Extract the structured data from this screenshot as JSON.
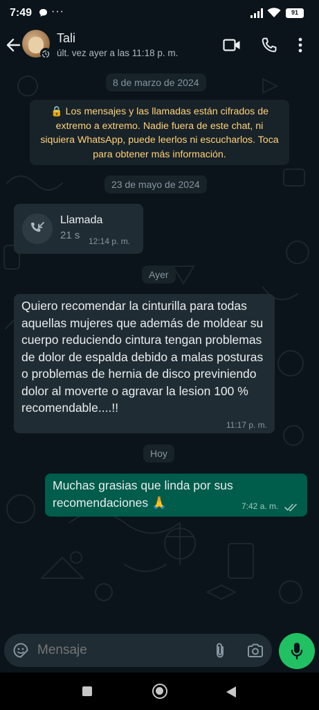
{
  "status_bar": {
    "time": "7:49",
    "dots": "···",
    "battery": "91"
  },
  "header": {
    "contact_name": "Tali",
    "last_seen": "últ. vez ayer a las 11:18 p. m.",
    "icons": [
      "back-arrow-icon",
      "video-call-icon",
      "phone-icon",
      "more-vertical-icon"
    ]
  },
  "chat": {
    "date_1": "8 de marzo de 2024",
    "encryption_notice": "🔒 Los mensajes y las llamadas están cifrados de extremo a extremo. Nadie fuera de este chat, ni siquiera WhatsApp, puede leerlos ni escucharlos. Toca para obtener más información.",
    "date_2": "23 de mayo de 2024",
    "call": {
      "label": "Llamada",
      "duration": "21 s",
      "time": "12:14 p. m."
    },
    "date_3": "Ayer",
    "message_1": {
      "text": "Quiero recomendar la cinturilla para todas aquellas mujeres que además de moldear su cuerpo reduciendo cintura tengan problemas de dolor de espalda debido a malas posturas o problemas de hernia de disco previniendo dolor al moverte  o agravar la lesion 100 % recomendable....!!",
      "time": "11:17 p. m."
    },
    "date_4": "Hoy",
    "message_2": {
      "text": "Muchas grasias que linda por sus recomendaciones 🙏",
      "time": "7:42 a. m.",
      "status": "read"
    }
  },
  "composer": {
    "placeholder": "Mensaje"
  },
  "colors": {
    "background": "#0b141a",
    "incoming_bubble": "#202c33",
    "outgoing_bubble": "#005c4b",
    "notice_text": "#ffd279",
    "accent_green": "#21c063"
  }
}
